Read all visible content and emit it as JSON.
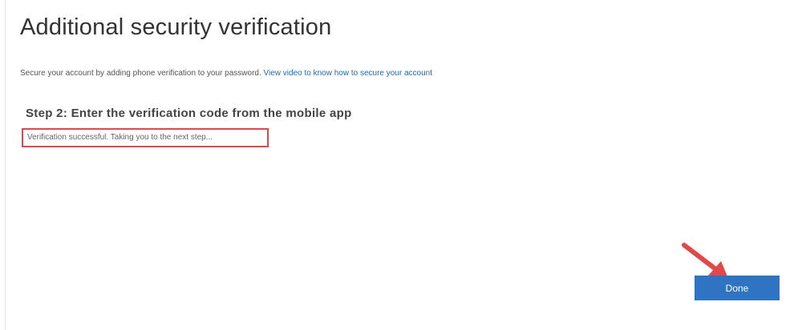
{
  "page": {
    "title": "Additional security verification",
    "intro_text": "Secure your account by adding phone verification to your password. ",
    "intro_link": "View video to know how to secure your account"
  },
  "step": {
    "heading": "Step 2: Enter the verification code from the mobile app",
    "status_message": "Verification successful. Taking you to the next step..."
  },
  "actions": {
    "done_label": "Done"
  },
  "colors": {
    "primary_button": "#2f74c3",
    "link": "#1b6bb5",
    "annotation_red": "#e0484a"
  },
  "icons": {
    "annotation": "arrow-pointer-icon"
  }
}
